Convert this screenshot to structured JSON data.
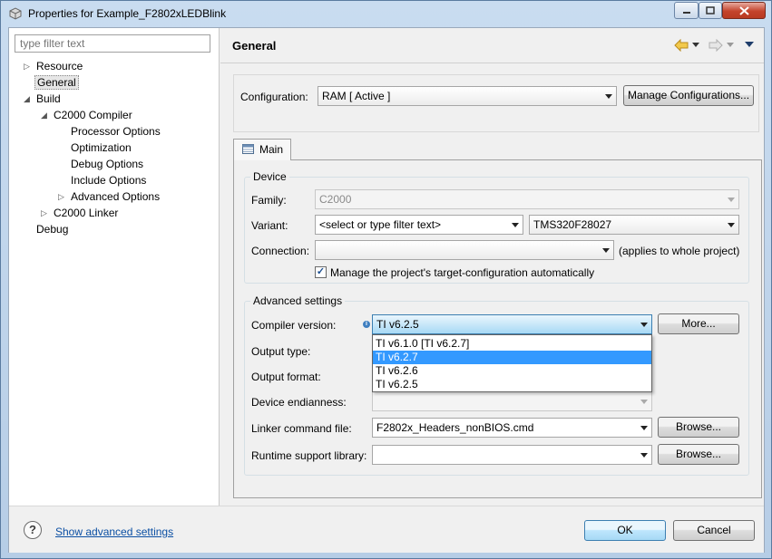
{
  "window": {
    "title": "Properties for Example_F2802xLEDBlink"
  },
  "left_pane": {
    "filter_placeholder": "type filter text",
    "tree": [
      {
        "label": "Resource"
      },
      {
        "label": "General",
        "selected": true
      },
      {
        "label": "Build"
      },
      {
        "label": "C2000 Compiler"
      },
      {
        "label": "Processor Options"
      },
      {
        "label": "Optimization"
      },
      {
        "label": "Debug Options"
      },
      {
        "label": "Include Options"
      },
      {
        "label": "Advanced Options"
      },
      {
        "label": "C2000 Linker"
      },
      {
        "label": "Debug"
      }
    ]
  },
  "main": {
    "title": "General",
    "configuration_label": "Configuration:",
    "configuration_value": "RAM  [ Active ]",
    "manage_configurations_button": "Manage Configurations...",
    "tab_main": "Main",
    "device": {
      "group_title": "Device",
      "family_label": "Family:",
      "family_value": "C2000",
      "variant_label": "Variant:",
      "variant_filter": "<select or type filter text>",
      "variant_value": "TMS320F28027",
      "connection_label": "Connection:",
      "connection_value": "",
      "connection_note": "(applies to whole project)",
      "manage_checkbox_label": "Manage the project's target-configuration automatically",
      "manage_checked": true
    },
    "advanced": {
      "group_title": "Advanced settings",
      "compiler_version_label": "Compiler version:",
      "compiler_version_value": "TI v6.2.5",
      "more_button": "More...",
      "compiler_options": [
        {
          "label": "TI v6.1.0  [TI v6.2.7]",
          "highlighted": false
        },
        {
          "label": "TI v6.2.7",
          "highlighted": true
        },
        {
          "label": "TI v6.2.6",
          "highlighted": false
        },
        {
          "label": "TI v6.2.5",
          "highlighted": false
        }
      ],
      "output_type_label": "Output type:",
      "output_format_label": "Output format:",
      "device_endianness_label": "Device endianness:",
      "linker_cmd_label": "Linker command file:",
      "linker_cmd_value": "F2802x_Headers_nonBIOS.cmd",
      "browse_button": "Browse...",
      "runtime_lib_label": "Runtime support library:",
      "runtime_lib_value": ""
    }
  },
  "bottom": {
    "show_advanced_link": "Show advanced settings",
    "ok_button": "OK",
    "cancel_button": "Cancel"
  },
  "colors": {
    "selection": "#3399ff",
    "link": "#0b4fa3",
    "close_button": "#c4432c"
  }
}
